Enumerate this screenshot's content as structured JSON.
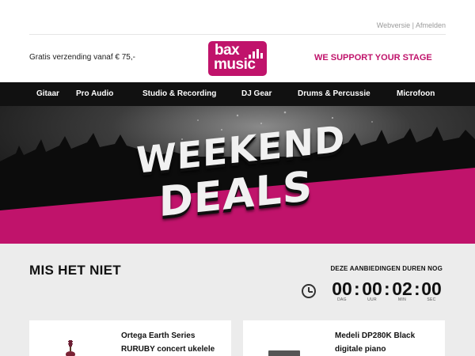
{
  "top_links": {
    "webversion": "Webversie",
    "separator": "|",
    "logout": "Afmelden"
  },
  "header": {
    "shipping_text": "Gratis verzending vanaf € 75,-",
    "logo_line1": "bax",
    "logo_line2": "music",
    "slogan": "WE SUPPORT YOUR STAGE",
    "brand_color": "#c0136b"
  },
  "nav": {
    "items": [
      {
        "label": "Gitaar"
      },
      {
        "label": "Pro Audio"
      },
      {
        "label": "Studio & Recording"
      },
      {
        "label": "DJ Gear"
      },
      {
        "label": "Drums & Percussie"
      },
      {
        "label": "Microfoon"
      }
    ]
  },
  "banner": {
    "line1": "WEEKEND",
    "line2": "DEALS"
  },
  "countdown": {
    "heading": "MIS HET NIET",
    "subheading": "DEZE AANBIEDINGEN DUREN NOG",
    "icon": "clock-icon",
    "units": [
      {
        "value": "00",
        "label": "DAG"
      },
      {
        "value": "00",
        "label": "UUR"
      },
      {
        "value": "02",
        "label": "MIN"
      },
      {
        "value": "00",
        "label": "SEC"
      }
    ],
    "separator": ":"
  },
  "products": [
    {
      "name_line1": "Ortega Earth Series",
      "name_line2": "RURUBY concert ukelele"
    },
    {
      "name_line1": "Medeli DP280K Black",
      "name_line2": "digitale piano"
    }
  ]
}
